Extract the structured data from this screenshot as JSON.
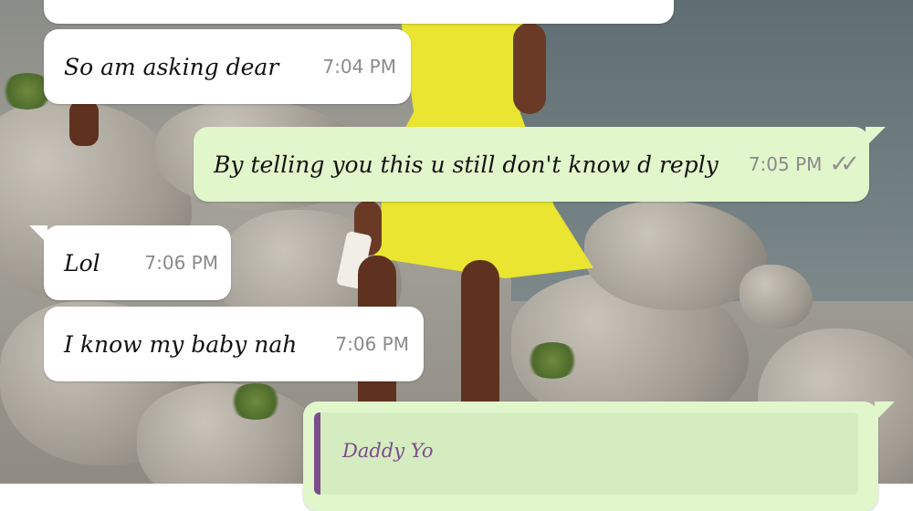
{
  "messages": [
    {
      "id": "top",
      "text": "",
      "time": "",
      "direction": "incoming"
    },
    {
      "id": "m1",
      "text": "So am asking dear",
      "time": "7:04 PM",
      "direction": "incoming"
    },
    {
      "id": "m2",
      "text": "By telling you this u still don't know d reply",
      "time": "7:05 PM",
      "direction": "outgoing",
      "status": "read"
    },
    {
      "id": "m3",
      "text": "Lol",
      "time": "7:06 PM",
      "direction": "incoming"
    },
    {
      "id": "m4",
      "text": "I know my baby nah",
      "time": "7:06 PM",
      "direction": "incoming"
    }
  ],
  "reply": {
    "quoted_author": "Daddy Yo",
    "quoted_text": "",
    "direction": "outgoing"
  },
  "icons": {
    "read_receipt": "double-check-icon"
  },
  "colors": {
    "incoming_bubble": "#ffffff",
    "outgoing_bubble": "#e1f6cb",
    "quote_accent": "#7c4d8b",
    "timestamp": "#8a8a8a"
  }
}
